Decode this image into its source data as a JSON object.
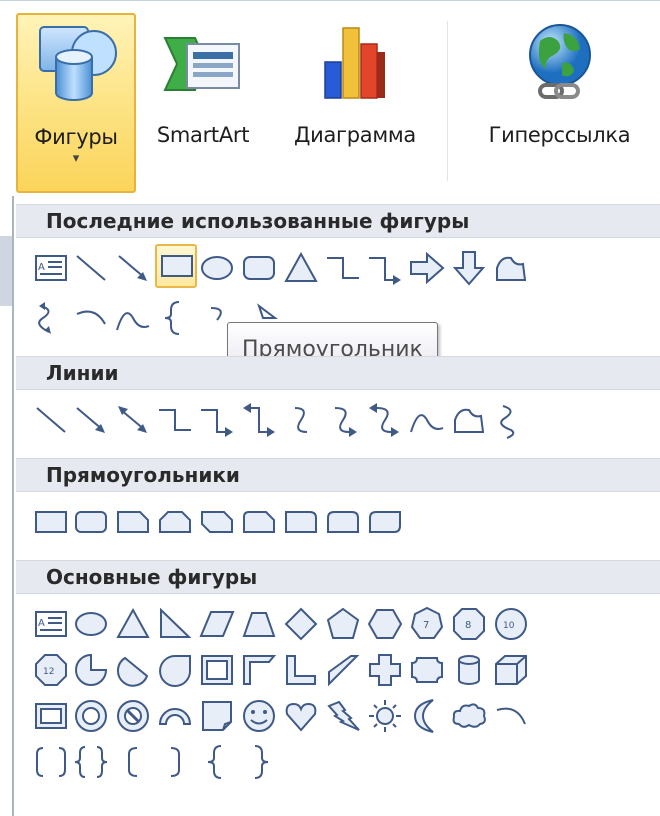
{
  "ribbon": {
    "buttons": [
      {
        "id": "shapes",
        "label": "Фигуры",
        "icon": "shapes-icon",
        "selected": true
      },
      {
        "id": "smartart",
        "label": "SmartArt",
        "icon": "smartart-icon"
      },
      {
        "id": "chart",
        "label": "Диаграмма",
        "icon": "chart-icon"
      },
      {
        "id": "hyperlink",
        "label": "Гиперссылка",
        "icon": "hyperlink-icon"
      }
    ]
  },
  "gallery": {
    "sections": [
      {
        "title": "Последние использованные фигуры"
      },
      {
        "title": "Линии"
      },
      {
        "title": "Прямоугольники"
      },
      {
        "title": "Основные фигуры"
      }
    ],
    "hovered_shape": "rectangle",
    "tooltip": "Прямоугольник"
  },
  "colors": {
    "shape_stroke": "#3f5a86",
    "shape_fill": "#e8eef7",
    "selected_bg": "#fde58a",
    "selected_border": "#e6b43c",
    "section_bg": "#e6e9ef"
  }
}
